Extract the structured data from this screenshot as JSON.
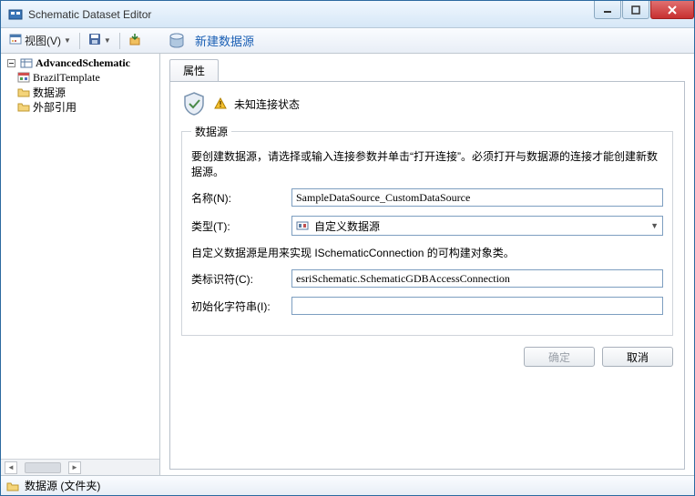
{
  "window": {
    "title": "Schematic Dataset Editor"
  },
  "toolbar": {
    "view_label": "视图(V)"
  },
  "tree": {
    "root": "AdvancedSchematic",
    "items": [
      {
        "label": "BrazilTemplate"
      },
      {
        "label": "数据源"
      },
      {
        "label": "外部引用"
      }
    ]
  },
  "main_header": {
    "link": "新建数据源"
  },
  "tabs": {
    "active": "属性"
  },
  "status": {
    "message": "未知连接状态"
  },
  "form": {
    "legend": "数据源",
    "hint": "要创建数据源，请选择或输入连接参数并单击“打开连接”。必须打开与数据源的连接才能创建新数据源。",
    "name_label": "名称(N):",
    "name_value": "SampleDataSource_CustomDataSource",
    "type_label": "类型(T):",
    "type_value": "自定义数据源",
    "note": "自定义数据源是用来实现 ISchematicConnection 的可构建对象类。",
    "classid_label": "类标识符(C):",
    "classid_value": "esriSchematic.SchematicGDBAccessConnection",
    "initstr_label": "初始化字符串(I):",
    "initstr_value": ""
  },
  "buttons": {
    "ok": "确定",
    "cancel": "取消"
  },
  "statusbar": {
    "text": "数据源 (文件夹)"
  }
}
